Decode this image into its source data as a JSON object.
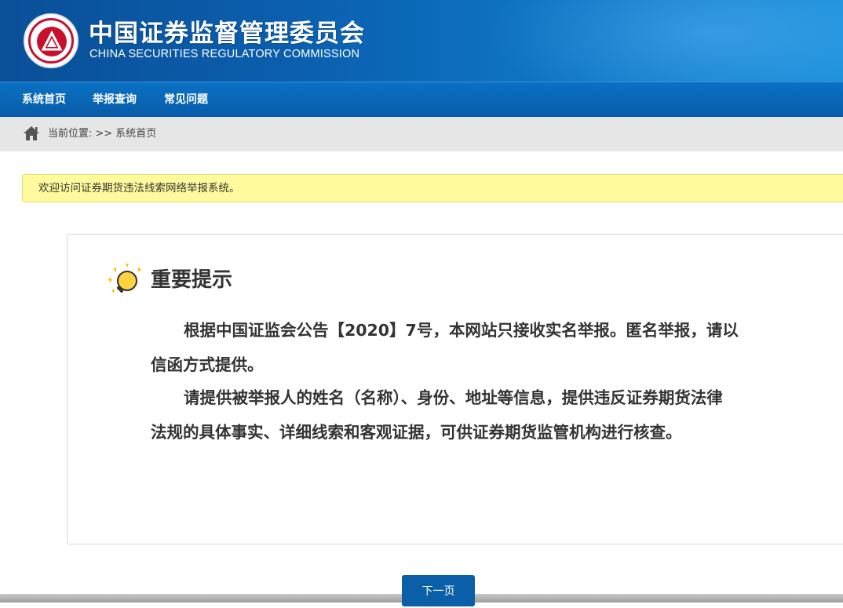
{
  "header": {
    "title_cn": "中国证券监督管理委员会",
    "title_en": "CHINA SECURITIES REGULATORY COMMISSION",
    "emblem_icon": "csrc-emblem-icon"
  },
  "nav": {
    "items": [
      {
        "label": "系统首页"
      },
      {
        "label": "举报查询"
      },
      {
        "label": "常见问题"
      }
    ]
  },
  "breadcrumb": {
    "icon": "home-icon",
    "label": "当前位置:",
    "separator": ">>",
    "current": "系统首页"
  },
  "notice": {
    "text": "欢迎访问证券期货违法线索网络举报系统。"
  },
  "panel": {
    "icon": "lightbulb-icon",
    "title": "重要提示",
    "paragraphs": [
      {
        "line1": "根据中国证监会公告【2020】7号，本网站只接收实名举报。匿名举报，请以",
        "line2": "信函方式提供。"
      },
      {
        "line1": "请提供被举报人的姓名（名称）、身份、地址等信息，提供违反证券期货法律",
        "line2": "法规的具体事实、详细线索和客观证据，可供证券期货监管机构进行核查。"
      }
    ]
  },
  "actions": {
    "next_label": "下一页"
  },
  "colors": {
    "header_blue": "#0b5fae",
    "nav_blue": "#075ca8",
    "notice_yellow": "#fffb9c",
    "emblem_red": "#c8102e",
    "button_blue": "#0b5ea8"
  }
}
